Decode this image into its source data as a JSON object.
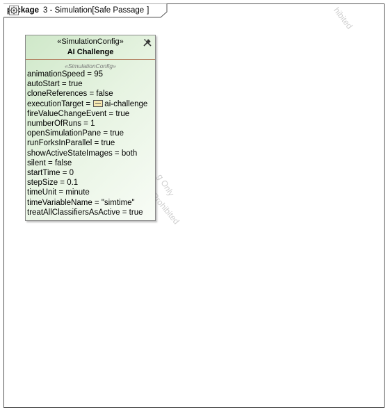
{
  "frame": {
    "keyword": "package",
    "title_prefix": "3 - Simulation[",
    "title_name": "Safe Passage",
    "title_suffix": "]"
  },
  "instance": {
    "stereotype": "«SimulationConfig»",
    "name": "AI Challenge",
    "compartment_title": "«SimulationConfig»",
    "slots": [
      "animationSpeed = 95",
      "autoStart = true",
      "cloneReferences = false",
      "executionTarget = ",
      "fireValueChangeEvent = true",
      "numberOfRuns = 1",
      "openSimulationPane = true",
      "runForksInParallel = true",
      "showActiveStateImages = both",
      "silent = false",
      "startTime = 0",
      "stepSize = 0.1",
      "timeUnit = minute",
      "timeVariableName = \"simtime\"",
      "treatAllClassifiersAsActive = true"
    ],
    "execution_target_value": "ai-challenge"
  },
  "watermarks": [
    "hibited",
    "g Only",
    "y Prohibited"
  ]
}
